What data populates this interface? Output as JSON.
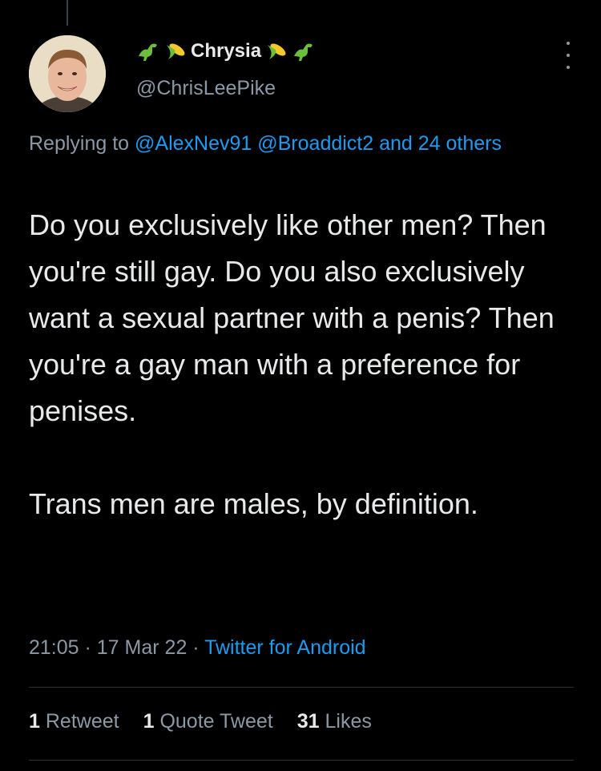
{
  "tweet": {
    "display_name": "Chrysia",
    "handle": "@ChrisLeePike",
    "reply_prefix": "Replying to ",
    "reply_mentions": "@AlexNev91 @Broaddict2",
    "reply_and": " and ",
    "reply_others": "24 others",
    "body": "Do you exclusively like other men? Then you're still gay. Do you also exclusively want a sexual partner with a penis? Then you're a gay man with a preference for penises.\n\nTrans men are males, by definition.",
    "time": "21:05",
    "date": "17 Mar 22",
    "source": "Twitter for Android",
    "separator": " · "
  },
  "stats": {
    "retweets_count": "1",
    "retweets_label": "Retweet",
    "quotes_count": "1",
    "quotes_label": "Quote Tweet",
    "likes_count": "31",
    "likes_label": "Likes"
  },
  "icons": {
    "name_emojis": [
      "dinosaur-icon",
      "corn-icon",
      "corn-icon",
      "dinosaur-icon"
    ],
    "more": "more-options-icon"
  },
  "colors": {
    "background": "#000000",
    "text": "#e7e9ea",
    "secondary": "#8b98a5",
    "link": "#1d9bf0"
  }
}
